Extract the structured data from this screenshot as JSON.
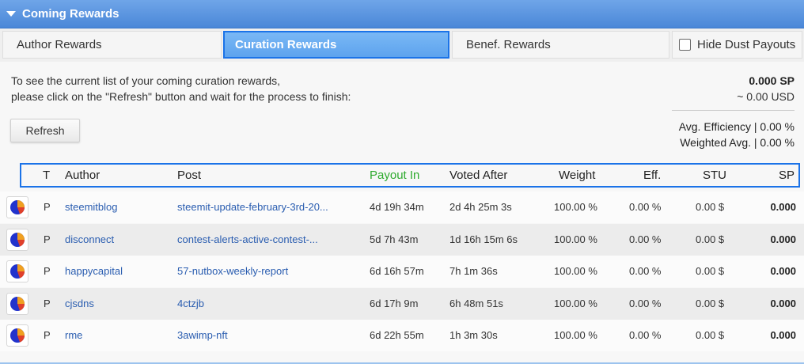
{
  "header": {
    "title": "Coming Rewards"
  },
  "tabs": [
    {
      "label": "Author Rewards"
    },
    {
      "label": "Curation Rewards"
    },
    {
      "label": "Benef. Rewards"
    }
  ],
  "hide_dust": {
    "label": "Hide Dust Payouts",
    "checked": false
  },
  "description": {
    "line1": "To see the current list of your coming curation rewards,",
    "line2": "please click on the \"Refresh\" button and wait for the process to finish:"
  },
  "totals": {
    "sp": "0.000 SP",
    "usd": "~ 0.00 USD",
    "avg_efficiency": "Avg. Efficiency | 0.00 %",
    "weighted_avg": "Weighted Avg. | 0.00 %"
  },
  "refresh_label": "Refresh",
  "columns": {
    "t": "T",
    "author": "Author",
    "post": "Post",
    "payout_in": "Payout In",
    "voted_after": "Voted After",
    "weight": "Weight",
    "eff": "Eff.",
    "stu": "STU",
    "sp": "SP"
  },
  "colors": {
    "header": "#4a87d8",
    "payout_highlight": "#2eaa2e",
    "link": "#2a5db0",
    "focus_border": "#1b73e8"
  },
  "rows": [
    {
      "t": "P",
      "author": "steemitblog",
      "post": "steemit-update-february-3rd-20...",
      "payout_in": "4d 19h 34m",
      "voted_after": "2d 4h 25m 3s",
      "weight": "100.00 %",
      "eff": "0.00 %",
      "stu": "0.00 $",
      "sp": "0.000"
    },
    {
      "t": "P",
      "author": "disconnect",
      "post": "contest-alerts-active-contest-...",
      "payout_in": "5d 7h 43m",
      "voted_after": "1d 16h 15m 6s",
      "weight": "100.00 %",
      "eff": "0.00 %",
      "stu": "0.00 $",
      "sp": "0.000"
    },
    {
      "t": "P",
      "author": "happycapital",
      "post": "57-nutbox-weekly-report",
      "payout_in": "6d 16h 57m",
      "voted_after": "7h 1m 36s",
      "weight": "100.00 %",
      "eff": "0.00 %",
      "stu": "0.00 $",
      "sp": "0.000"
    },
    {
      "t": "P",
      "author": "cjsdns",
      "post": "4ctzjb",
      "payout_in": "6d 17h 9m",
      "voted_after": "6h 48m 51s",
      "weight": "100.00 %",
      "eff": "0.00 %",
      "stu": "0.00 $",
      "sp": "0.000"
    },
    {
      "t": "P",
      "author": "rme",
      "post": "3awimp-nft",
      "payout_in": "6d 22h 55m",
      "voted_after": "1h 3m 30s",
      "weight": "100.00 %",
      "eff": "0.00 %",
      "stu": "0.00 $",
      "sp": "0.000"
    }
  ]
}
